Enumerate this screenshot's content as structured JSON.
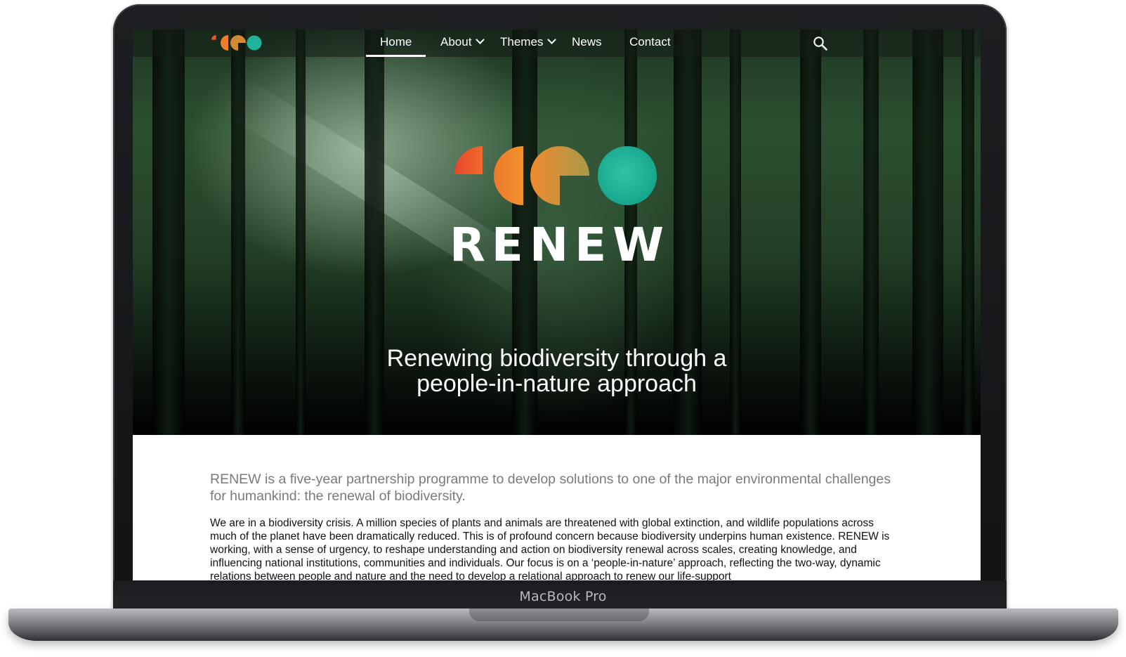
{
  "nav": {
    "items": [
      {
        "label": "Home",
        "active": true
      },
      {
        "label": "About",
        "dropdown": true
      },
      {
        "label": "Themes",
        "dropdown": true
      },
      {
        "label": "News"
      },
      {
        "label": "Contact"
      }
    ],
    "search_icon": "search-icon"
  },
  "hero": {
    "brand": "RENEW",
    "tagline_line1": "Renewing biodiversity through a",
    "tagline_line2": "people-in-nature approach",
    "logo_colors": [
      "#e8562a",
      "#ee7d2c",
      "#c98a3a",
      "#21b29a"
    ]
  },
  "content": {
    "lead": "RENEW is a five-year partnership programme to develop solutions to one of the major environmental challenges for humankind: the renewal of biodiversity.",
    "body": "We are in a biodiversity crisis. A million species of plants and animals are threatened with global extinction, and wildlife populations across much of the planet have been dramatically reduced. This is of profound concern because biodiversity underpins human existence. RENEW is working, with a sense of urgency, to reshape understanding and action on biodiversity renewal across scales, creating knowledge, and influencing national institutions, communities and individuals. Our focus is on a ‘people-in-nature’ approach, reflecting the two-way, dynamic relations between people and nature and the need to develop a relational approach to renew our life-support"
  },
  "device": {
    "label": "MacBook Pro"
  }
}
